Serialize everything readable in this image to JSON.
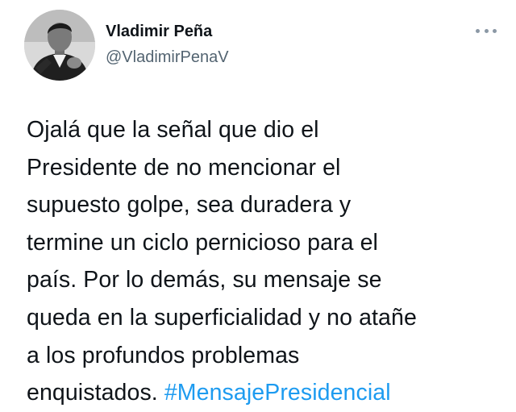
{
  "tweet": {
    "author": {
      "display_name": "Vladimir Peña",
      "handle": "@VladimirPenaV"
    },
    "more_icon": "ellipsis-icon",
    "text_lines": [
      "Ojalá que la señal que dio el",
      "Presidente de no mencionar el",
      "supuesto golpe, sea duradera y",
      "termine un ciclo pernicioso para el",
      "país. Por lo demás, su mensaje se",
      "queda en la superficialidad y no atañe",
      "a los profundos problemas"
    ],
    "last_line_text": "enquistados. ",
    "hashtag": "#MensajePresidencial",
    "hashtag_color": "#1d9bf0"
  }
}
